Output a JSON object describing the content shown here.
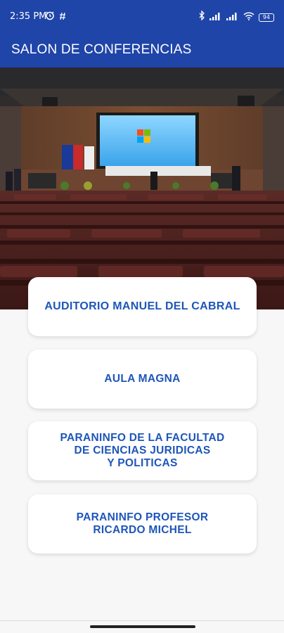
{
  "status_bar": {
    "time": "2:35 PM",
    "battery": "94",
    "icons": [
      "alarm-icon",
      "hash-icon",
      "bluetooth-icon",
      "signal-icon",
      "signal-icon",
      "wifi-icon",
      "battery-icon"
    ]
  },
  "app_bar": {
    "title": "SALON DE CONFERENCIAS",
    "background": "#1f45a9"
  },
  "hero": {
    "description_icon": "auditorium-image"
  },
  "venues": [
    {
      "label": "AUDITORIO MANUEL DEL CABRAL"
    },
    {
      "label": "AULA MAGNA"
    },
    {
      "label": "PARANINFO DE LA FACULTAD\nDE CIENCIAS JURIDICAS\nY POLITICAS"
    },
    {
      "label": "PARANINFO PROFESOR\nRICARDO MICHEL"
    }
  ],
  "colors": {
    "accent": "#1e56b8",
    "card_background": "#ffffff",
    "page_background": "#f7f7f7"
  }
}
